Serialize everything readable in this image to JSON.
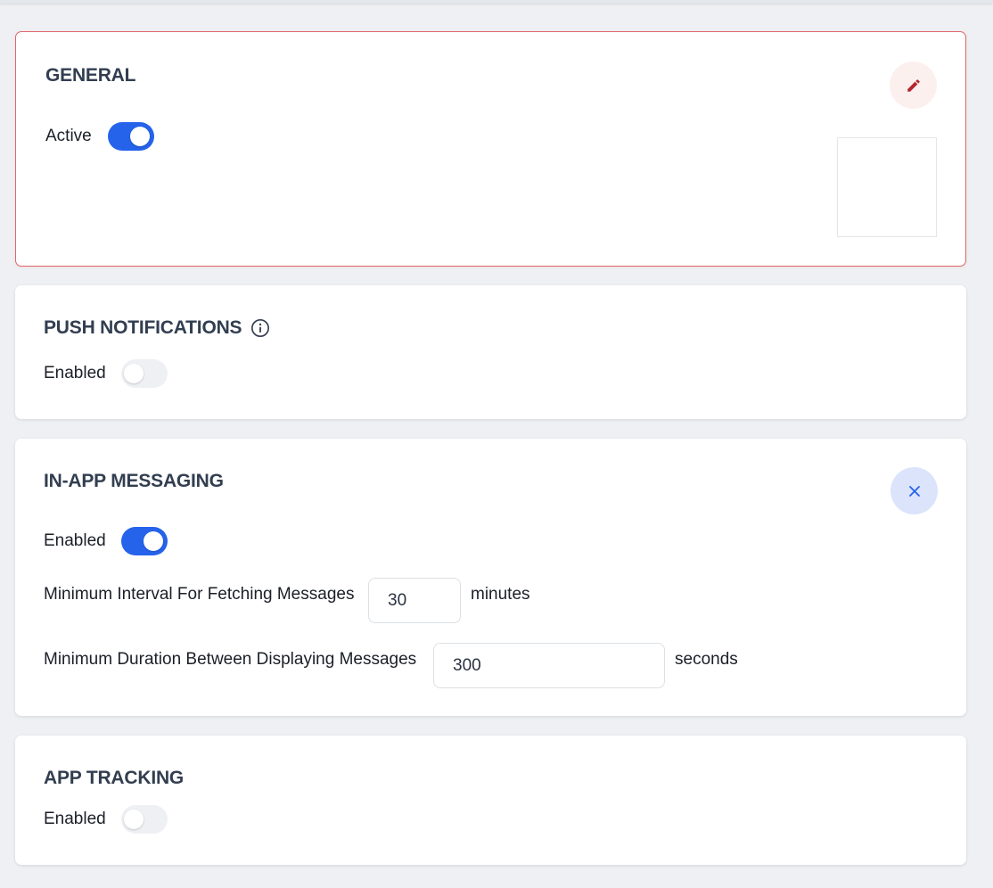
{
  "general": {
    "title": "GENERAL",
    "active_label": "Active",
    "active_on": true,
    "edit_icon": "pencil-icon"
  },
  "push": {
    "title": "PUSH NOTIFICATIONS",
    "info_icon": "info-icon",
    "enabled_label": "Enabled",
    "enabled_on": false
  },
  "in_app": {
    "title": "IN-APP MESSAGING",
    "close_icon": "close-icon",
    "enabled_label": "Enabled",
    "enabled_on": true,
    "fetch_interval": {
      "label": "Minimum Interval For Fetching Messages",
      "value": "30",
      "unit": "minutes"
    },
    "display_duration": {
      "label": "Minimum Duration Between Displaying Messages",
      "value": "300",
      "unit": "seconds"
    }
  },
  "tracking": {
    "title": "APP TRACKING",
    "enabled_label": "Enabled",
    "enabled_on": false
  },
  "colors": {
    "accent": "#2563eb",
    "toggle_off": "#eef0f3",
    "edit_border": "#e0666b",
    "edit_icon": "#b3262b",
    "close_icon": "#2563eb"
  }
}
